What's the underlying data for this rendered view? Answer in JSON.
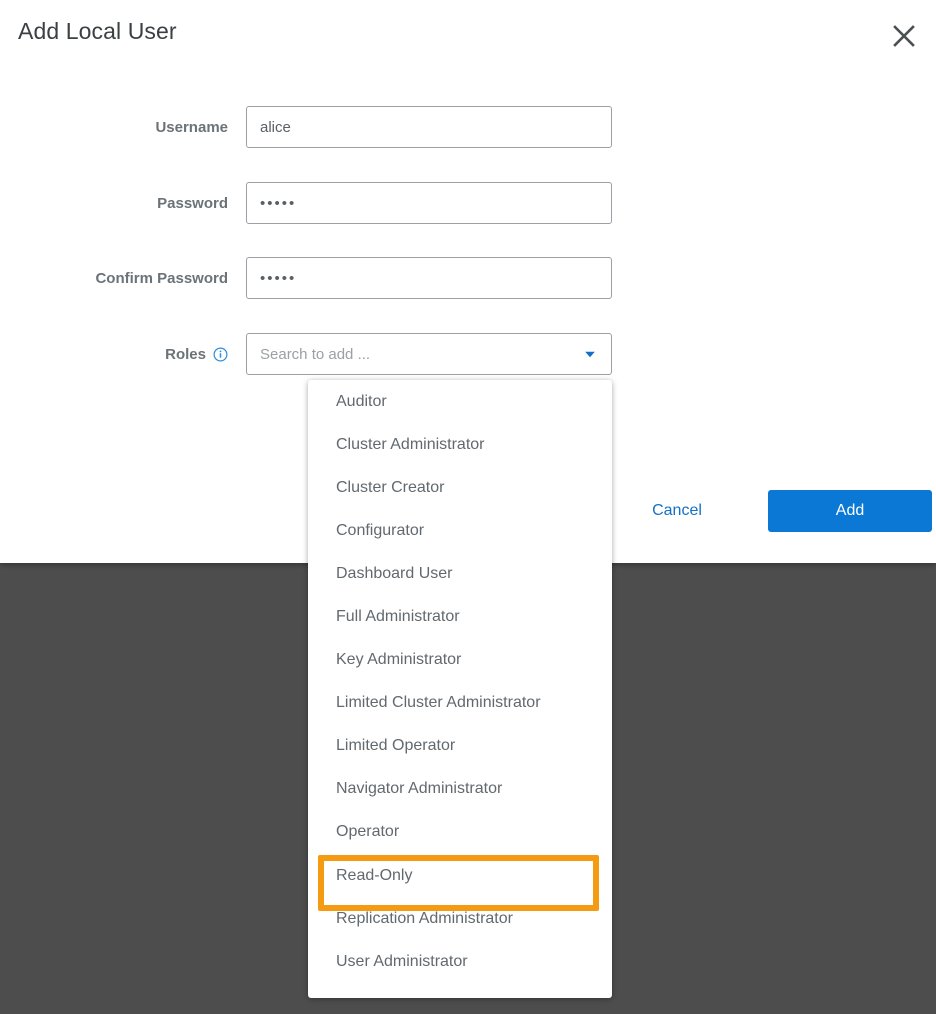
{
  "modal": {
    "title": "Add Local User",
    "close_icon": "close-icon",
    "fields": {
      "username": {
        "label": "Username",
        "value": "alice",
        "placeholder": ""
      },
      "password": {
        "label": "Password",
        "value": "•••••",
        "placeholder": ""
      },
      "confirm_password": {
        "label": "Confirm Password",
        "value": "•••••",
        "placeholder": ""
      },
      "roles": {
        "label": "Roles",
        "info_icon": "info-circle-icon",
        "value": "",
        "placeholder": "Search to add ...",
        "caret_icon": "chevron-down-icon"
      }
    },
    "footer": {
      "cancel_label": "Cancel",
      "add_label": "Add"
    }
  },
  "roles_dropdown": {
    "open": true,
    "highlighted_option": "Read-Only",
    "options": [
      "Auditor",
      "Cluster Administrator",
      "Cluster Creator",
      "Configurator",
      "Dashboard User",
      "Full Administrator",
      "Key Administrator",
      "Limited Cluster Administrator",
      "Limited Operator",
      "Navigator Administrator",
      "Operator",
      "Read-Only",
      "Replication Administrator",
      "User Administrator"
    ]
  },
  "colors": {
    "accent_blue": "#0a78d4",
    "link_blue": "#1271c7",
    "highlight_orange": "#f59b11",
    "overlay_gray": "#4d4d4d",
    "label_gray": "#6b7378",
    "option_gray": "#62696e",
    "border_gray": "#9aa0a4"
  }
}
